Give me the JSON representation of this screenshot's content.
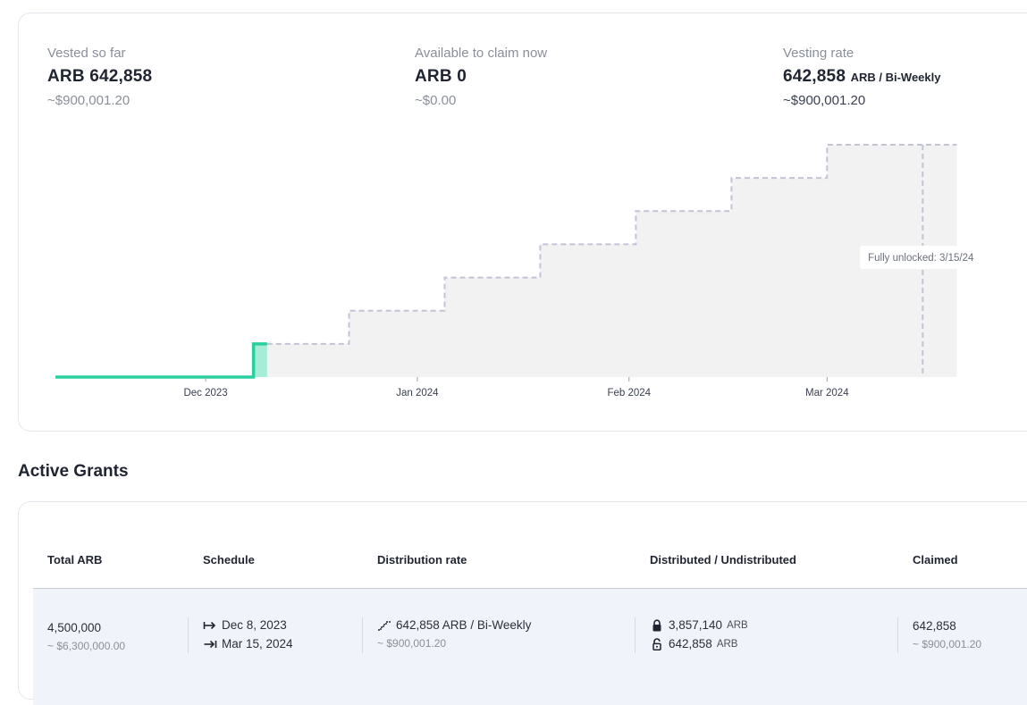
{
  "summary": {
    "vested": {
      "label": "Vested so far",
      "amount": "ARB 642,858",
      "usd": "~$900,001.20"
    },
    "available": {
      "label": "Available to claim now",
      "amount": "ARB 0",
      "usd": "~$0.00"
    },
    "rate": {
      "label": "Vesting rate",
      "amount": "642,858",
      "unit": "ARB / Bi-Weekly",
      "usd": "~$900,001.20"
    }
  },
  "chart_data": {
    "type": "line",
    "title": "",
    "xlabel": "",
    "ylabel": "",
    "x_ticks": [
      "Dec 2023",
      "Jan 2024",
      "Feb 2024",
      "Mar 2024"
    ],
    "annotation": "Fully unlocked: 3/15/24",
    "grid": false,
    "series": [
      {
        "style": "solid",
        "color": "#2bcf9f",
        "x": [
          "2023-11-09",
          "2023-12-08",
          "2023-12-08",
          "2023-12-10"
        ],
        "y": [
          0,
          0,
          642858,
          642858
        ]
      },
      {
        "style": "dashed",
        "color": "#c2c4d6",
        "x": [
          "2023-12-10",
          "2023-12-22",
          "2023-12-22",
          "2024-01-05",
          "2024-01-05",
          "2024-01-19",
          "2024-01-19",
          "2024-02-02",
          "2024-02-02",
          "2024-02-16",
          "2024-02-16",
          "2024-03-01",
          "2024-03-01",
          "2024-03-15",
          "2024-03-15",
          "2024-03-20"
        ],
        "y": [
          642858,
          642858,
          1285716,
          1285716,
          1928574,
          1928574,
          2571432,
          2571432,
          3214290,
          3214290,
          3857148,
          3857148,
          4500006,
          4500006,
          4500006,
          4500006
        ]
      }
    ],
    "colors": {
      "vested": "#2bcf9f",
      "vested_fill": "#a6ecd6",
      "projection": "#c2c4d6",
      "area": "#f2f2f2"
    }
  },
  "grants": {
    "title": "Active Grants",
    "headers": [
      "Total ARB",
      "Schedule",
      "Distribution rate",
      "Distributed / Undistributed",
      "Claimed"
    ],
    "row": {
      "total": "4,500,000",
      "total_usd": "~ $6,300,000.00",
      "start": "Dec 8, 2023",
      "end": "Mar 15, 2024",
      "rate": "642,858 ARB / Bi-Weekly",
      "rate_usd": "~ $900,001.20",
      "distributed": "3,857,140",
      "undistributed": "642,858",
      "token": "ARB",
      "claimed": "642,858",
      "claimed_usd": "~ $900,001.20"
    },
    "icons": {
      "start": "arrow-right-bar-icon",
      "end": "arrow-to-bar-icon",
      "rate": "step-chart-icon",
      "distributed": "lock-closed-icon",
      "undistributed": "lock-open-icon"
    }
  }
}
